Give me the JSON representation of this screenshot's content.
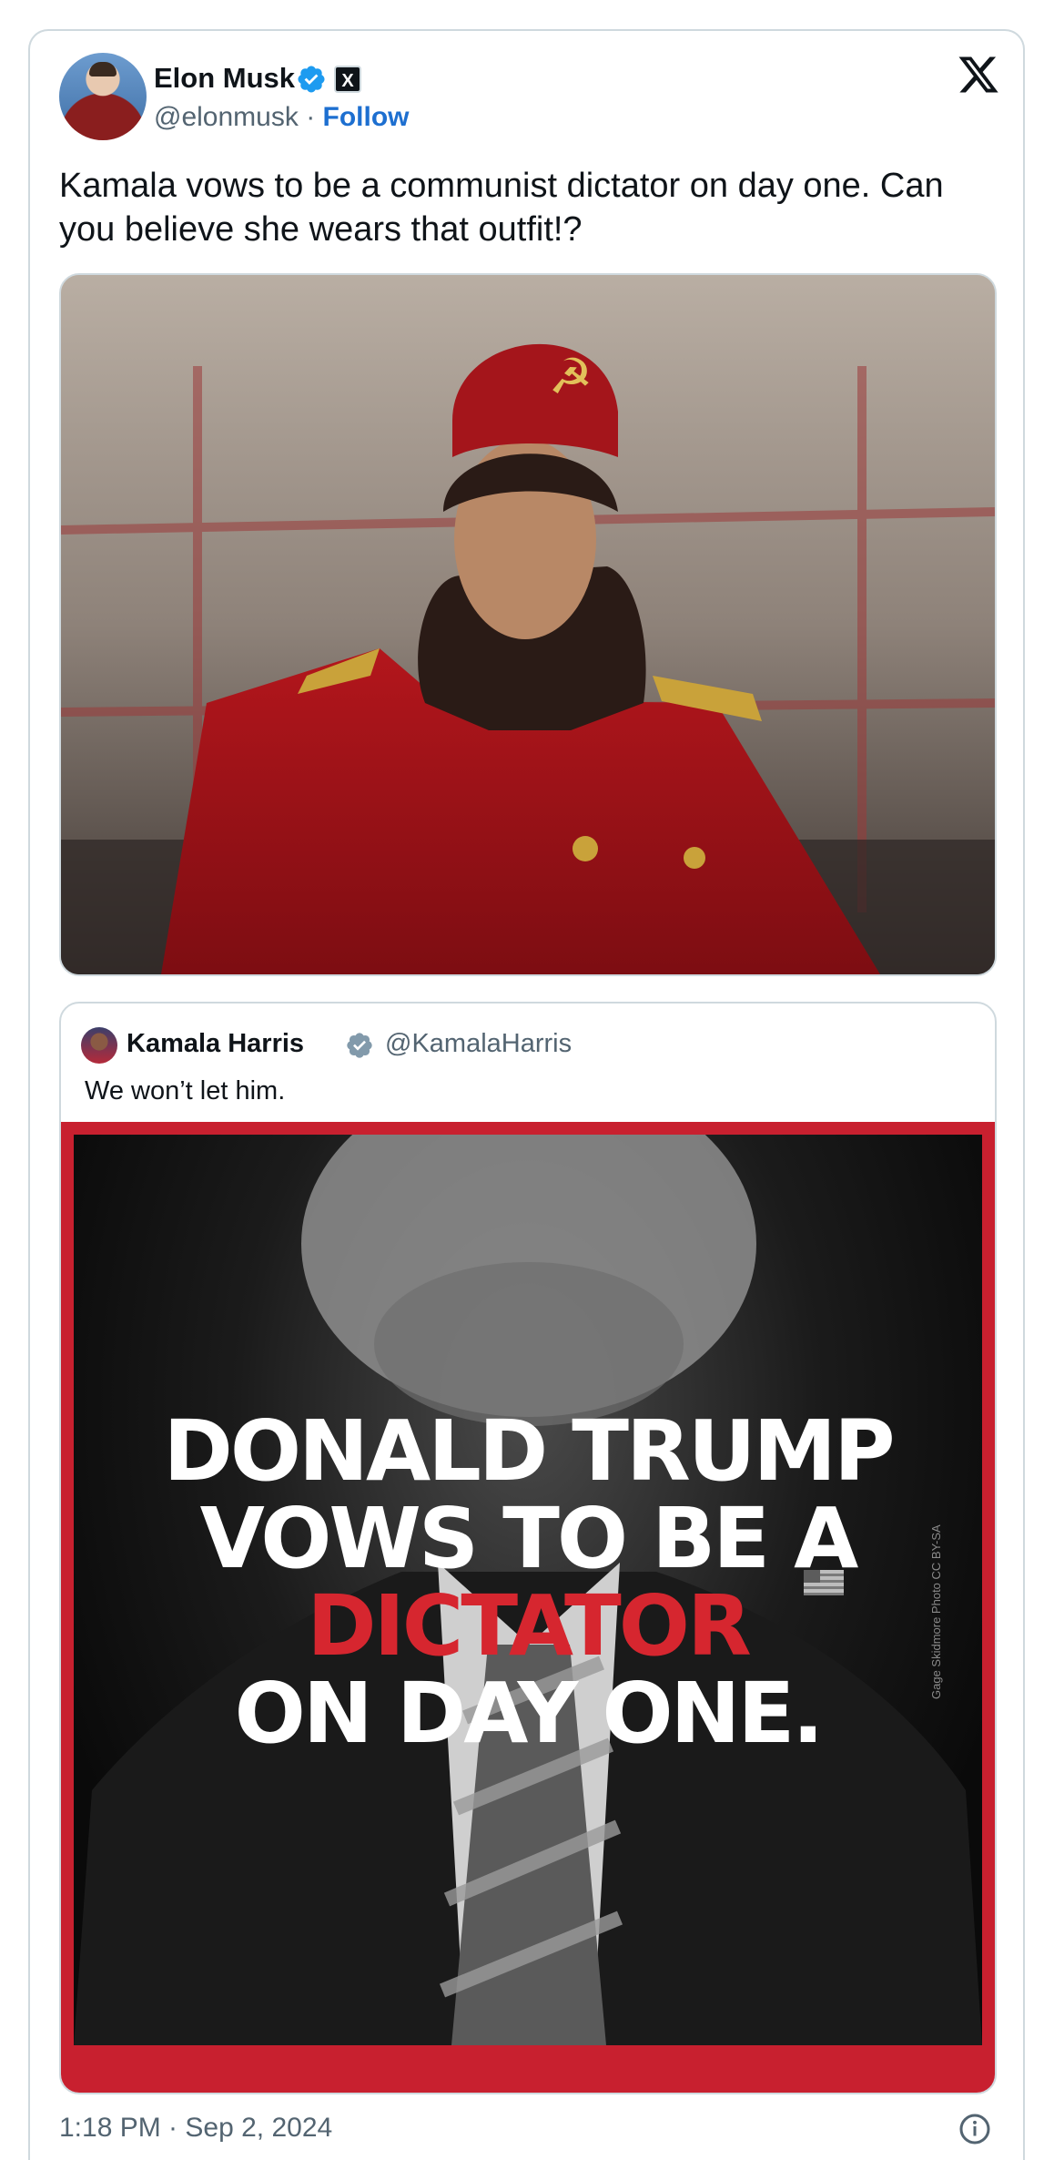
{
  "author": {
    "name": "Elon Musk",
    "handle": "@elonmusk",
    "separator": " · ",
    "follow_label": "Follow",
    "affiliation_badge": "X"
  },
  "tweet": {
    "text": "Kamala vows to be a communist dictator on day one. Can you believe she wears that outfit!?"
  },
  "quoted_tweet": {
    "author_name": "Kamala Harris",
    "author_handle": "@KamalaHarris",
    "text": "We won’t let him.",
    "media": {
      "headline_line1": "DONALD TRUMP",
      "headline_line2": "VOWS TO BE A",
      "headline_line3": "DICTATOR",
      "headline_line4": "ON DAY ONE.",
      "photo_credit": "Gage Skidmore Photo CC BY-SA"
    }
  },
  "footer": {
    "timestamp": "1:18 PM · Sep 2, 2024"
  },
  "icons": {
    "verified": "verified-badge-icon",
    "x_logo": "x-logo-icon",
    "info": "info-icon"
  },
  "colors": {
    "link_blue": "#1d6fd0",
    "verified_blue": "#1d9bf0",
    "verified_gray": "#829aab",
    "headline_red": "#d6262f",
    "frame_red": "#c8202f",
    "muted_text": "#536471"
  }
}
